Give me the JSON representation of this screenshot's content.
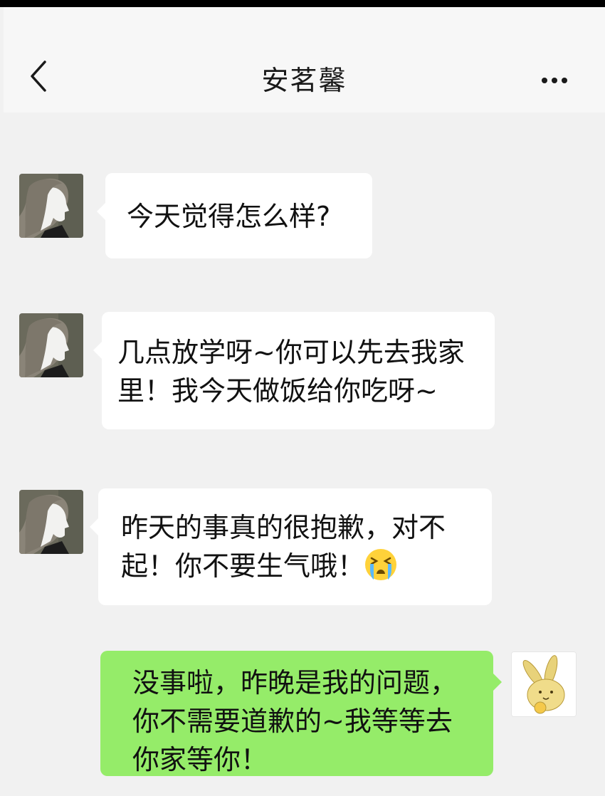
{
  "header": {
    "title": "安茗馨",
    "back_icon": "chevron-left-icon",
    "more_icon": "more-dots-icon"
  },
  "messages": [
    {
      "side": "incoming",
      "text": "今天觉得怎么样?"
    },
    {
      "side": "incoming",
      "text": "几点放学呀~你可以先去我家里！我今天做饭给你吃呀~"
    },
    {
      "side": "incoming",
      "text": "昨天的事真的很抱歉，对不起！你不要生气哦！",
      "emoji": "crying-face-emoji"
    },
    {
      "side": "outgoing",
      "text": "没事啦，昨晚是我的问题，你不需要道歉的~我等等去你家等你！"
    }
  ],
  "colors": {
    "background": "#f1f1f1",
    "header": "#f7f7f7",
    "incoming_bubble": "#ffffff",
    "outgoing_bubble": "#95ec69"
  }
}
